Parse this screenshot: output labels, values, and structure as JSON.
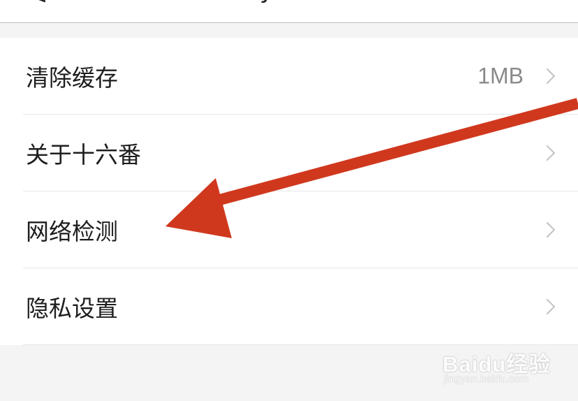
{
  "header": {
    "back_glyph": "<",
    "title_fragment": "y"
  },
  "settings": {
    "items": [
      {
        "label": "清除缓存",
        "value": "1MB"
      },
      {
        "label": "关于十六番",
        "value": ""
      },
      {
        "label": "网络检测",
        "value": ""
      },
      {
        "label": "隐私设置",
        "value": ""
      }
    ]
  },
  "annotation": {
    "arrow_color": "#d0381e",
    "points_to": "网络检测"
  },
  "watermark": {
    "brand": "Baidu经验",
    "url": "jingyan.baidu.com"
  },
  "colors": {
    "background": "#f4f4f4",
    "row_background": "#ffffff",
    "label": "#1e1e1e",
    "value": "#8a8a8a"
  }
}
